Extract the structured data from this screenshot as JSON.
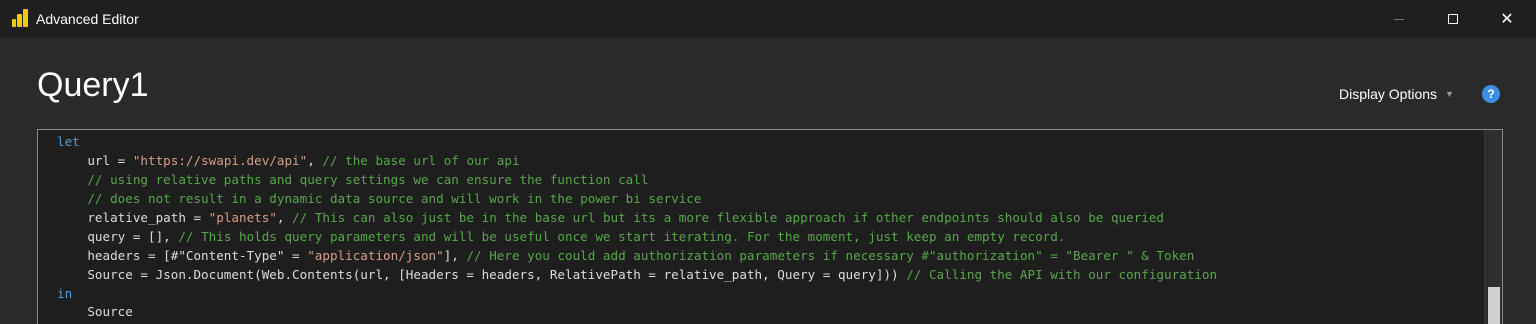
{
  "window": {
    "title": "Advanced Editor",
    "close_glyph": "✕"
  },
  "header": {
    "query_name": "Query1",
    "display_options_label": "Display Options",
    "display_options_caret": "▼",
    "help_glyph": "?"
  },
  "colors": {
    "keyword": "#569cd6",
    "string": "#d69d85",
    "comment": "#57a64a",
    "text": "#dcdcdc",
    "help_icon": "#3a8ee6",
    "app_icon": "#f2c811"
  },
  "icons": [
    "power-bi-logo-icon",
    "minimize-icon",
    "maximize-icon",
    "close-icon",
    "dropdown-caret-icon",
    "help-icon"
  ],
  "code": [
    [
      {
        "k": "kw",
        "t": "let"
      }
    ],
    [
      {
        "k": "plain",
        "t": "    url = "
      },
      {
        "k": "str",
        "t": "\"https://swapi.dev/api\""
      },
      {
        "k": "plain",
        "t": ", "
      },
      {
        "k": "cm",
        "t": "// the base url of our api"
      }
    ],
    [
      {
        "k": "cm",
        "t": "    // using relative paths and query settings we can ensure the function call"
      }
    ],
    [
      {
        "k": "cm",
        "t": "    // does not result in a dynamic data source and will work in the power bi service"
      }
    ],
    [
      {
        "k": "plain",
        "t": "    relative_path = "
      },
      {
        "k": "str",
        "t": "\"planets\""
      },
      {
        "k": "plain",
        "t": ", "
      },
      {
        "k": "cm",
        "t": "// This can also just be in the base url but its a more flexible approach if other endpoints should also be queried"
      }
    ],
    [
      {
        "k": "plain",
        "t": "    query = [], "
      },
      {
        "k": "cm",
        "t": "// This holds query parameters and will be useful once we start iterating. For the moment, just keep an empty record."
      }
    ],
    [
      {
        "k": "plain",
        "t": "    headers = [#\"Content-Type\" = "
      },
      {
        "k": "str",
        "t": "\"application/json\""
      },
      {
        "k": "plain",
        "t": "], "
      },
      {
        "k": "cm",
        "t": "// Here you could add authorization parameters if necessary #\"authorization\" = \"Bearer \" & Token"
      }
    ],
    [
      {
        "k": "plain",
        "t": "    Source = Json.Document(Web.Contents(url, [Headers = headers, RelativePath = relative_path, Query = query])) "
      },
      {
        "k": "cm",
        "t": "// Calling the API with our configuration"
      }
    ],
    [
      {
        "k": "kw",
        "t": "in"
      }
    ],
    [
      {
        "k": "plain",
        "t": "    Source"
      }
    ]
  ]
}
